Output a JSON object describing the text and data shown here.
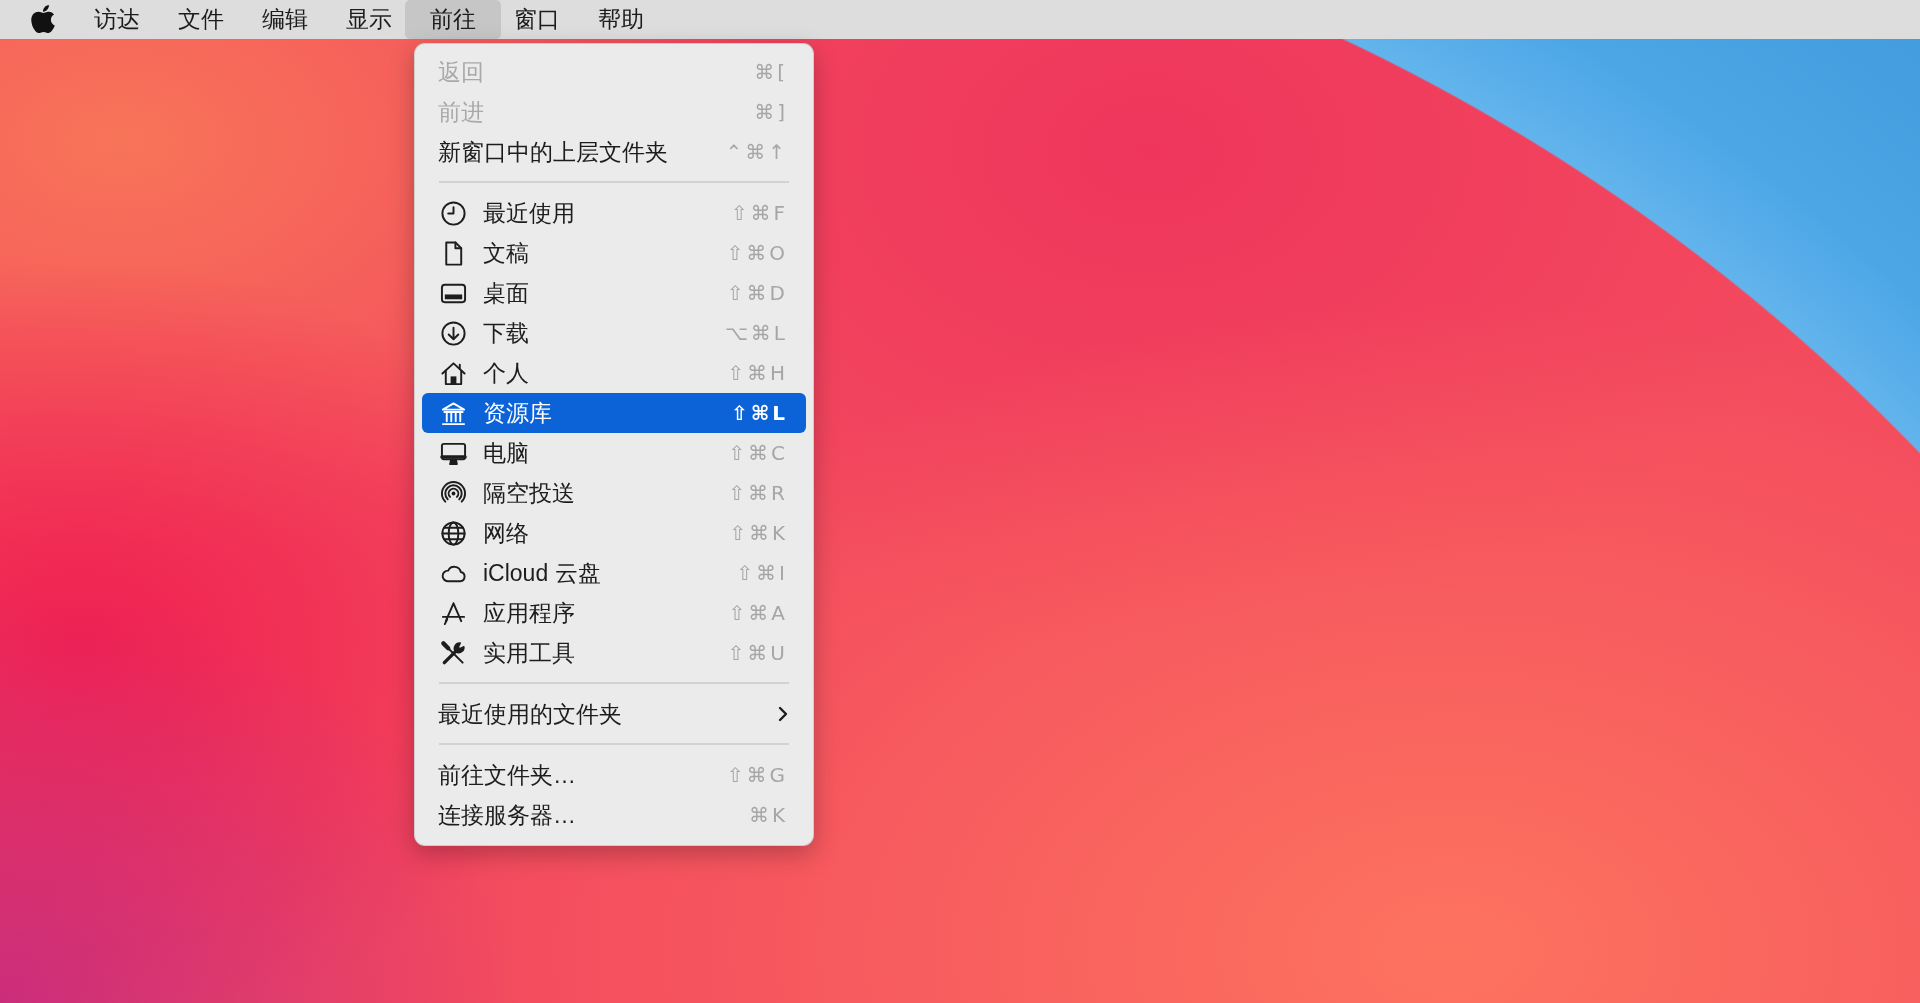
{
  "menu_bar": {
    "items": [
      {
        "label": "访达",
        "selected": false
      },
      {
        "label": "文件",
        "selected": false
      },
      {
        "label": "编辑",
        "selected": false
      },
      {
        "label": "显示",
        "selected": false
      },
      {
        "label": "前往",
        "selected": true
      },
      {
        "label": "窗口",
        "selected": false
      },
      {
        "label": "帮助",
        "selected": false
      }
    ]
  },
  "dropdown": {
    "groups": [
      {
        "items": [
          {
            "kind": "plain",
            "label": "返回",
            "shortcut": "⌘[",
            "disabled": true,
            "selected": false
          },
          {
            "kind": "plain",
            "label": "前进",
            "shortcut": "⌘]",
            "disabled": true,
            "selected": false
          },
          {
            "kind": "plain",
            "label": "新窗口中的上层文件夹",
            "shortcut": "⌃⌘↑",
            "disabled": false,
            "selected": false
          }
        ]
      },
      {
        "items": [
          {
            "kind": "icon",
            "label": "最近使用",
            "shortcut": "⇧⌘F",
            "disabled": false,
            "selected": false
          },
          {
            "kind": "icon",
            "label": "文稿",
            "shortcut": "⇧⌘O",
            "disabled": false,
            "selected": false
          },
          {
            "kind": "icon",
            "label": "桌面",
            "shortcut": "⇧⌘D",
            "disabled": false,
            "selected": false
          },
          {
            "kind": "icon",
            "label": "下载",
            "shortcut": "⌥⌘L",
            "disabled": false,
            "selected": false
          },
          {
            "kind": "icon",
            "label": "个人",
            "shortcut": "⇧⌘H",
            "disabled": false,
            "selected": false
          },
          {
            "kind": "icon",
            "label": "资源库",
            "shortcut": "⇧⌘L",
            "disabled": false,
            "selected": true
          },
          {
            "kind": "icon",
            "label": "电脑",
            "shortcut": "⇧⌘C",
            "disabled": false,
            "selected": false
          },
          {
            "kind": "icon",
            "label": "隔空投送",
            "shortcut": "⇧⌘R",
            "disabled": false,
            "selected": false
          },
          {
            "kind": "icon",
            "label": "网络",
            "shortcut": "⇧⌘K",
            "disabled": false,
            "selected": false
          },
          {
            "kind": "icon",
            "label": "iCloud 云盘",
            "shortcut": "⇧⌘I",
            "disabled": false,
            "selected": false
          },
          {
            "kind": "icon",
            "label": "应用程序",
            "shortcut": "⇧⌘A",
            "disabled": false,
            "selected": false
          },
          {
            "kind": "icon",
            "label": "实用工具",
            "shortcut": "⇧⌘U",
            "disabled": false,
            "selected": false
          }
        ]
      },
      {
        "items": [
          {
            "kind": "submenu",
            "label": "最近使用的文件夹",
            "disabled": false,
            "selected": false
          }
        ]
      },
      {
        "items": [
          {
            "kind": "plain",
            "label": "前往文件夹…",
            "shortcut": "⇧⌘G",
            "disabled": false,
            "selected": false
          },
          {
            "kind": "plain",
            "label": "连接服务器…",
            "shortcut": "⌘K",
            "disabled": false,
            "selected": false
          }
        ]
      }
    ]
  }
}
